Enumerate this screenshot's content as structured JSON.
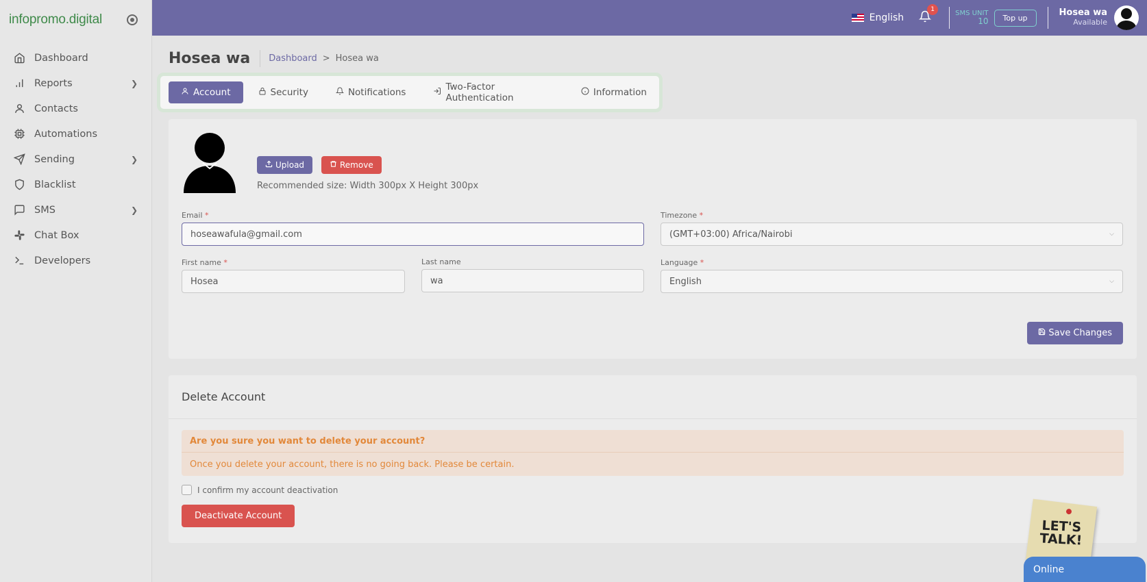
{
  "brand": {
    "name": "infopromo.digital"
  },
  "sidebar": {
    "items": [
      {
        "label": "Dashboard",
        "icon": "home-icon",
        "has_children": false
      },
      {
        "label": "Reports",
        "icon": "bar-chart-icon",
        "has_children": true
      },
      {
        "label": "Contacts",
        "icon": "user-icon",
        "has_children": false
      },
      {
        "label": "Automations",
        "icon": "cpu-icon",
        "has_children": false
      },
      {
        "label": "Sending",
        "icon": "send-icon",
        "has_children": true
      },
      {
        "label": "Blacklist",
        "icon": "shield-icon",
        "has_children": false
      },
      {
        "label": "SMS",
        "icon": "message-icon",
        "has_children": true
      },
      {
        "label": "Chat Box",
        "icon": "slack-icon",
        "has_children": false
      },
      {
        "label": "Developers",
        "icon": "terminal-icon",
        "has_children": false
      }
    ]
  },
  "topbar": {
    "language": "English",
    "notification_count": "1",
    "sms_unit_label": "SMS UNIT",
    "sms_unit_value": "10",
    "topup_label": "Top up",
    "user_name": "Hosea wa",
    "user_status": "Available"
  },
  "page": {
    "title": "Hosea wa",
    "breadcrumb": {
      "home": "Dashboard",
      "separator": ">",
      "current": "Hosea wa"
    }
  },
  "tabs": [
    {
      "label": "Account",
      "icon": "user-icon",
      "active": true
    },
    {
      "label": "Security",
      "icon": "lock-icon",
      "active": false
    },
    {
      "label": "Notifications",
      "icon": "bell-icon",
      "active": false
    },
    {
      "label": "Two-Factor Authentication",
      "icon": "login-icon",
      "active": false
    },
    {
      "label": "Information",
      "icon": "info-icon",
      "active": false
    }
  ],
  "account": {
    "upload_label": "Upload",
    "remove_label": "Remove",
    "recommended_size": "Recommended size: Width 300px X Height 300px",
    "email_label": "Email",
    "email_value": "hoseawafula@gmail.com",
    "timezone_label": "Timezone",
    "timezone_value": "(GMT+03:00) Africa/Nairobi",
    "first_name_label": "First name",
    "first_name_value": "Hosea",
    "last_name_label": "Last name",
    "last_name_value": "wa",
    "language_label": "Language",
    "language_value": "English",
    "save_label": "Save Changes"
  },
  "delete_account": {
    "title": "Delete Account",
    "alert_heading": "Are you sure you want to delete your account?",
    "alert_body": "Once you delete your account, there is no going back. Please be certain.",
    "confirm_label": "I confirm my account deactivation",
    "deactivate_label": "Deactivate Account"
  },
  "chat_widget": {
    "sticky_line1": "LET'S",
    "sticky_line2": "TALK!",
    "status": "Online"
  },
  "colors": {
    "primary": "#6c69a4",
    "danger": "#d9534f",
    "warning_text": "#e2883a",
    "chat_blue": "#4a82cf"
  }
}
